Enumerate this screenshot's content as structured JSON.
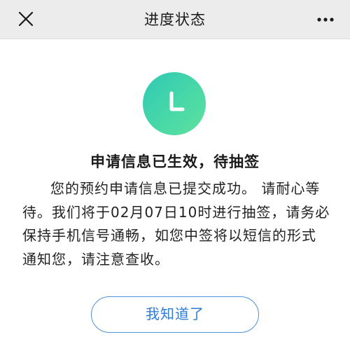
{
  "nav": {
    "title": "进度状态",
    "close_icon": "close-icon",
    "more_icon": "more-icon"
  },
  "status": {
    "icon": "clock-icon",
    "icon_color": "#3fd0ae",
    "heading": "申请信息已生效，待抽签",
    "message": "您的预约申请信息已提交成功。 请耐心等待。我们将于02月07日10时进行抽签，请务必保持手机信号通畅，如您中签将以短信的形式通知您，请注意查收。"
  },
  "actions": {
    "confirm_label": "我知道了",
    "accent_color": "#2f7bd6"
  }
}
